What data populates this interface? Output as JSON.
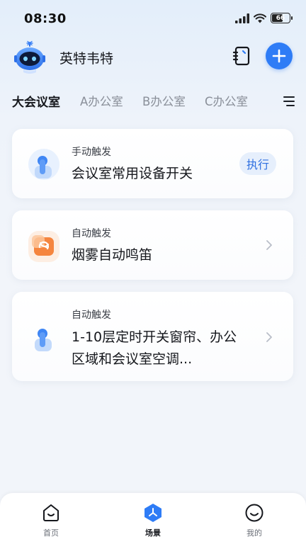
{
  "status_bar": {
    "time": "08:30",
    "battery": "66",
    "battery_level": 0.66,
    "icons": [
      "signal-icon",
      "wifi-icon",
      "battery-icon"
    ]
  },
  "header": {
    "home_name": "英特韦特",
    "avatar_icon": "robot-avatar-icon",
    "device_icon": "device-panel-icon",
    "add_icon": "plus-icon"
  },
  "tabs": [
    {
      "label": "大会议室",
      "active": true
    },
    {
      "label": "A办公室",
      "active": false
    },
    {
      "label": "B办公室",
      "active": false
    },
    {
      "label": "C办公室",
      "active": false
    }
  ],
  "tab_menu_icon": "menu-icon",
  "scenes": [
    {
      "trigger": "手动触发",
      "title": "会议室常用设备开关",
      "action": "执行",
      "icon": "hand-touch-icon"
    },
    {
      "trigger": "自动触发",
      "title": "烟雾自动鸣笛",
      "icon": "smoke-alarm-icon"
    },
    {
      "trigger": "自动触发",
      "title": "1-10层定时开关窗帘、办公区域和会议室空调...",
      "icon": "hand-touch-icon"
    }
  ],
  "bottom_nav": [
    {
      "label": "首页",
      "icon": "home-icon",
      "active": false
    },
    {
      "label": "场景",
      "icon": "scene-icon",
      "active": true
    },
    {
      "label": "我的",
      "icon": "profile-icon",
      "active": false
    }
  ],
  "colors": {
    "accent": "#2e7cf6",
    "run_button_bg": "#e6effc",
    "run_button_text": "#2e6fe0",
    "smoke_icon": "#f5853f"
  }
}
